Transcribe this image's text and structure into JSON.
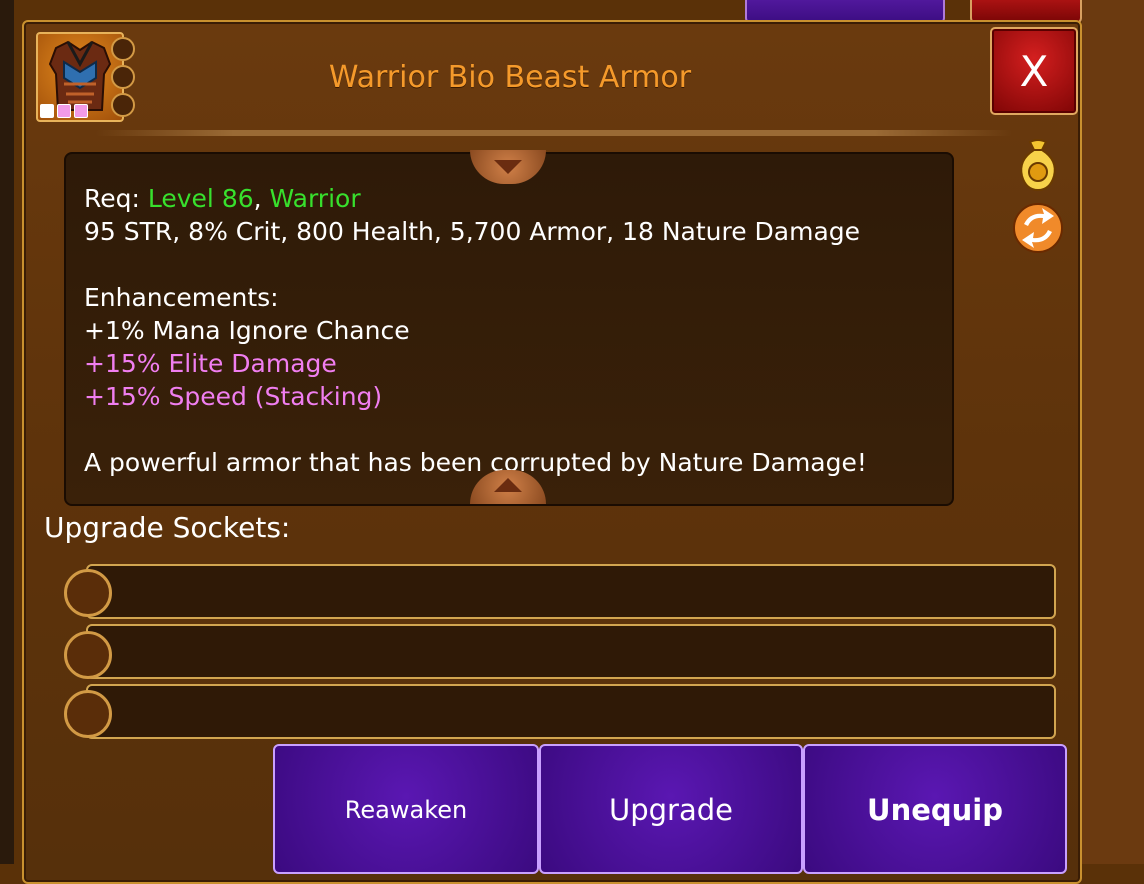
{
  "item": {
    "name": "Warrior Bio Beast Armor",
    "icon": "chest-armor-icon",
    "rarity_dots": [
      "white",
      "pink",
      "pink"
    ],
    "icon_socket_count": 3
  },
  "close_label": "X",
  "description": {
    "req_prefix": "Req: ",
    "req_level": "Level 86",
    "req_sep": ", ",
    "req_class": "Warrior",
    "stats": "95 STR, 8% Crit, 800 Health, 5,700 Armor, 18 Nature Damage",
    "enhancements_title": "Enhancements:",
    "enhancements": [
      {
        "text": "+1% Mana Ignore Chance",
        "color": "#ffffff"
      },
      {
        "text": "+15% Elite Damage",
        "color": "#f07ef0"
      },
      {
        "text": "+15% Speed (Stacking)",
        "color": "#f07ef0"
      }
    ],
    "flavor": "A powerful armor that has been corrupted by Nature Damage!"
  },
  "side_icons": [
    "gold-bag-icon",
    "swap-icon"
  ],
  "upgrade_sockets": {
    "label": "Upgrade Sockets:",
    "count": 3
  },
  "buttons": {
    "reawaken": "Reawaken",
    "upgrade": "Upgrade",
    "unequip": "Unequip"
  },
  "colors": {
    "title": "#f59a2b",
    "requirement": "#38e02d",
    "special_enhancement": "#f07ef0",
    "button_purple": "#4a10a0",
    "close_red": "#b01010"
  }
}
